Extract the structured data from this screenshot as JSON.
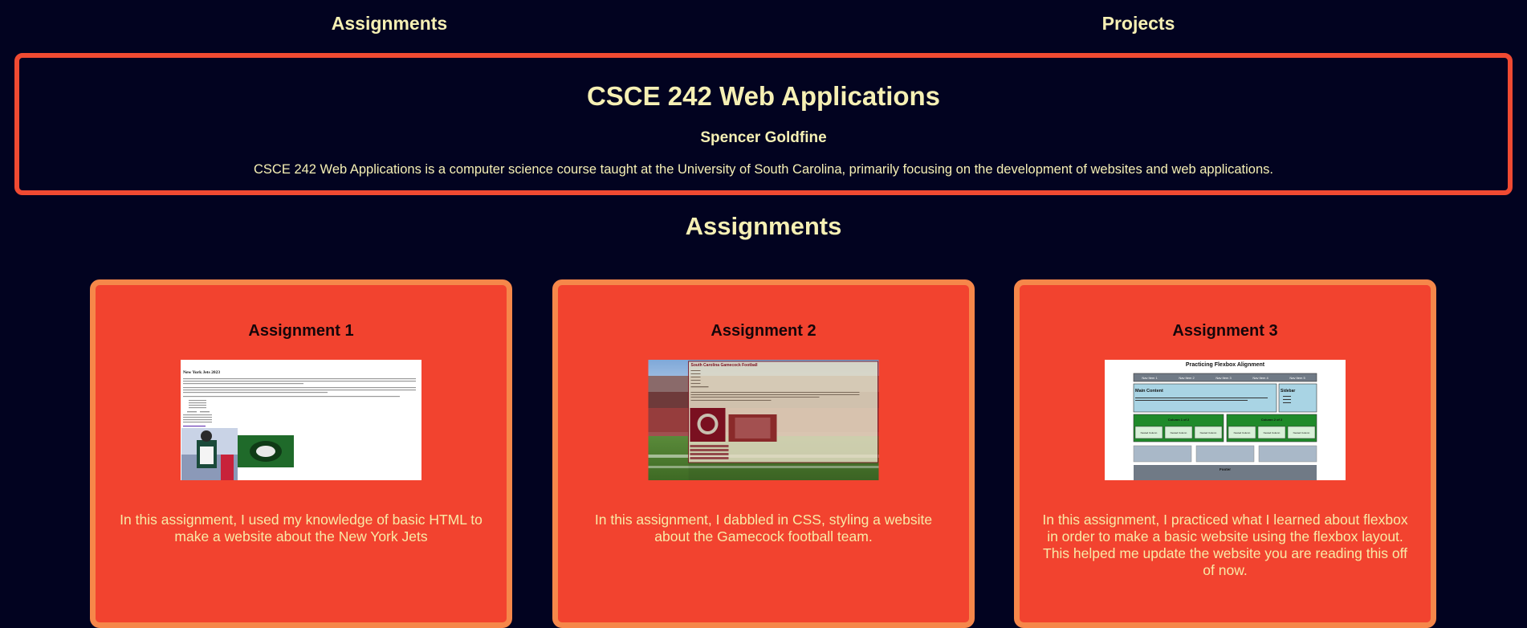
{
  "nav": {
    "assignments_label": "Assignments",
    "projects_label": "Projects"
  },
  "hero": {
    "title": "CSCE 242 Web Applications",
    "author": "Spencer Goldfine",
    "description": "CSCE 242 Web Applications is a computer science course taught at the University of South Carolina, primarily focusing on the development of websites and web applications."
  },
  "section": {
    "title": "Assignments"
  },
  "cards": [
    {
      "title": "Assignment 1",
      "description": "In this assignment, I used my knowledge of basic HTML to make a website about the New York Jets",
      "thumbnail": {
        "heading": "New York Jets 2023"
      }
    },
    {
      "title": "Assignment 2",
      "description": "In this assignment, I dabbled in CSS, styling a website about the Gamecock football team.",
      "thumbnail": {
        "heading": "South Carolina Gamecock Football"
      }
    },
    {
      "title": "Assignment 3",
      "description": "In this assignment, I practiced what I learned about flexbox in order to make a basic website using the flexbox layout. This helped me update the website you are reading this off of now.",
      "thumbnail": {
        "heading": "Practicing Flexbox Alignment",
        "main_label": "Main Content",
        "sidebar_label": "Sidebar",
        "footer_label": "Footer",
        "nav_items": [
          "Nav Item 1",
          "Nav Item 2",
          "Nav Item 3",
          "Nav Item 4",
          "Nav Item 5"
        ],
        "column_labels": [
          "Column 1 of 2",
          "Column 2 of 2"
        ],
        "nested_label": "Nested Column"
      }
    }
  ],
  "colors": {
    "background": "#020320",
    "text": "#f6f0b4",
    "accent_red": "#f04a32",
    "card_border": "#f6874a"
  }
}
